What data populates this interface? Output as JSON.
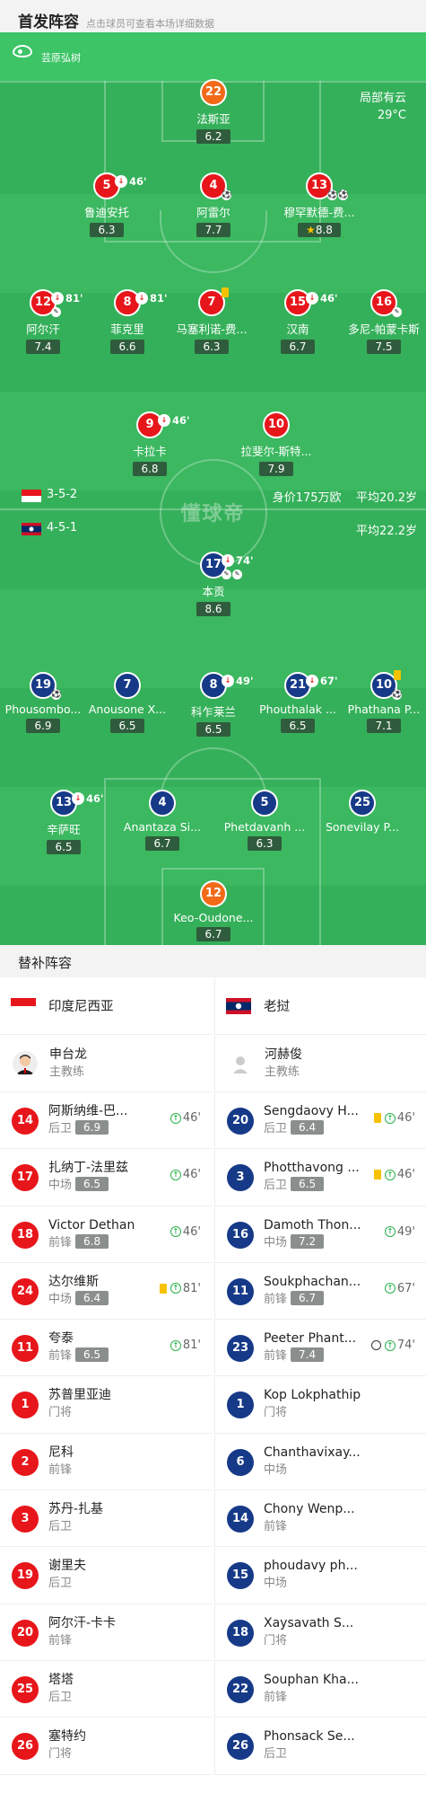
{
  "header": {
    "title": "首发阵容",
    "subtitle": "点击球员可查看本场详细数据"
  },
  "referee": {
    "name": "芸原弘树"
  },
  "weather": {
    "condition": "局部有云",
    "temp": "29°C"
  },
  "home": {
    "formation": "3-5-2",
    "value": "身价175万欧",
    "avg_age": "平均20.2岁",
    "players": [
      {
        "num": "22",
        "name": "法斯亚",
        "rating": "6.2",
        "keeper": true
      },
      {
        "num": "5",
        "name": "鲁迪安托",
        "rating": "6.3",
        "sub": "46'"
      },
      {
        "num": "4",
        "name": "阿雷尔",
        "rating": "7.7"
      },
      {
        "num": "13",
        "name": "穆罕默德-费...",
        "rating": "8.8"
      },
      {
        "num": "12",
        "name": "阿尔汗",
        "rating": "7.4",
        "sub": "81'"
      },
      {
        "num": "8",
        "name": "菲克里",
        "rating": "6.6",
        "sub": "81'"
      },
      {
        "num": "7",
        "name": "马塞利诺-费...",
        "rating": "6.3"
      },
      {
        "num": "15",
        "name": "汉南",
        "rating": "6.7",
        "sub": "46'"
      },
      {
        "num": "16",
        "name": "多尼-帕蒙卡斯",
        "rating": "7.5"
      },
      {
        "num": "9",
        "name": "卡拉卡",
        "rating": "6.8",
        "sub": "46'"
      },
      {
        "num": "10",
        "name": "拉斐尔-斯特...",
        "rating": "7.9"
      }
    ]
  },
  "away": {
    "formation": "4-5-1",
    "avg_age": "平均22.2岁",
    "players": [
      {
        "num": "17",
        "name": "本贡",
        "rating": "8.6",
        "sub": "74'"
      },
      {
        "num": "19",
        "name": "Phousombo...",
        "rating": "6.9"
      },
      {
        "num": "7",
        "name": "Anousone X...",
        "rating": "6.5"
      },
      {
        "num": "8",
        "name": "科乍莱兰",
        "rating": "6.5",
        "sub": "49'"
      },
      {
        "num": "21",
        "name": "Phouthalak ...",
        "rating": "6.5",
        "sub": "67'"
      },
      {
        "num": "10",
        "name": "Phathana P...",
        "rating": "7.1"
      },
      {
        "num": "13",
        "name": "辛萨旺",
        "rating": "6.5",
        "sub": "46'"
      },
      {
        "num": "4",
        "name": "Anantaza Si...",
        "rating": "6.7"
      },
      {
        "num": "5",
        "name": "Phetdavanh ...",
        "rating": "6.3"
      },
      {
        "num": "25",
        "name": "Sonevilay P...",
        "rating": ""
      },
      {
        "num": "12",
        "name": "Keo-Oudone...",
        "rating": "6.7",
        "keeper": true
      }
    ]
  },
  "watermark": "懂球帝",
  "subs_title": "替补阵容",
  "subs": {
    "home": {
      "team": "印度尼西亚",
      "coach": {
        "name": "申台龙",
        "role": "主教练"
      },
      "players": [
        {
          "num": "14",
          "name": "阿斯纳维-巴...",
          "pos": "后卫",
          "rating": "6.9",
          "time": "46'"
        },
        {
          "num": "17",
          "name": "扎纳丁-法里兹",
          "pos": "中场",
          "rating": "6.5",
          "time": "46'"
        },
        {
          "num": "18",
          "name": "Victor Dethan",
          "pos": "前锋",
          "rating": "6.8",
          "time": "46'"
        },
        {
          "num": "24",
          "name": "达尔维斯",
          "pos": "中场",
          "rating": "6.4",
          "time": "81'",
          "card": true
        },
        {
          "num": "11",
          "name": "夸泰",
          "pos": "前锋",
          "rating": "6.5",
          "time": "81'"
        },
        {
          "num": "1",
          "name": "苏普里亚迪",
          "pos": "门将"
        },
        {
          "num": "2",
          "name": "尼科",
          "pos": "前锋"
        },
        {
          "num": "3",
          "name": "苏丹-扎基",
          "pos": "后卫"
        },
        {
          "num": "19",
          "name": "谢里夫",
          "pos": "后卫"
        },
        {
          "num": "20",
          "name": "阿尔汗-卡卡",
          "pos": "前锋"
        },
        {
          "num": "25",
          "name": "塔塔",
          "pos": "后卫"
        },
        {
          "num": "26",
          "name": "塞特约",
          "pos": "门将"
        }
      ]
    },
    "away": {
      "team": "老挝",
      "coach": {
        "name": "河赫俊",
        "role": "主教练"
      },
      "players": [
        {
          "num": "20",
          "name": "Sengdaovy H...",
          "pos": "后卫",
          "rating": "6.4",
          "time": "46'",
          "card": true
        },
        {
          "num": "3",
          "name": "Photthavong ...",
          "pos": "后卫",
          "rating": "6.5",
          "time": "46'",
          "card": true
        },
        {
          "num": "16",
          "name": "Damoth Thon...",
          "pos": "中场",
          "rating": "7.2",
          "time": "49'"
        },
        {
          "num": "11",
          "name": "Soukphachan...",
          "pos": "前锋",
          "rating": "6.7",
          "time": "67'"
        },
        {
          "num": "23",
          "name": "Peeter Phant...",
          "pos": "前锋",
          "rating": "7.4",
          "time": "74'",
          "goal": true
        },
        {
          "num": "1",
          "name": "Kop Lokphathip",
          "pos": "门将"
        },
        {
          "num": "6",
          "name": "Chanthavixay...",
          "pos": "中场"
        },
        {
          "num": "14",
          "name": "Chony Wenp...",
          "pos": "前锋"
        },
        {
          "num": "15",
          "name": "phoudavy ph...",
          "pos": "中场"
        },
        {
          "num": "18",
          "name": "Xaysavath S...",
          "pos": "门将"
        },
        {
          "num": "22",
          "name": "Souphan Kha...",
          "pos": "前锋"
        },
        {
          "num": "26",
          "name": "Phonsack Se...",
          "pos": "后卫"
        }
      ]
    }
  },
  "colors": {
    "home": "#e7161b",
    "away": "#163a88",
    "keeper": "#f26a18",
    "pitch": "#35b05a"
  }
}
